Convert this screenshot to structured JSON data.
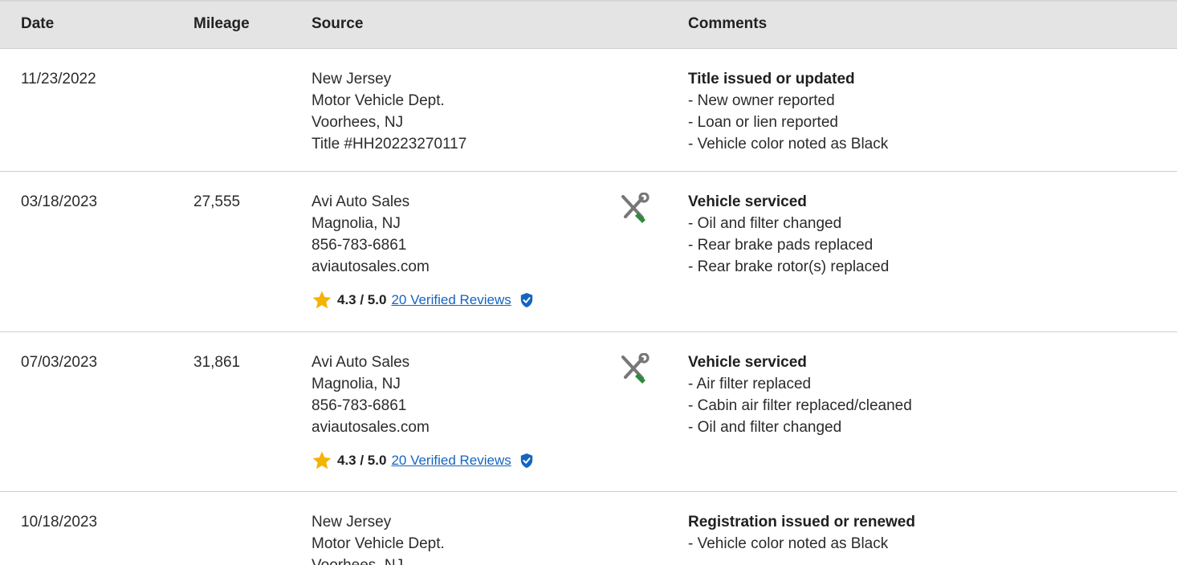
{
  "header": {
    "date": "Date",
    "mileage": "Mileage",
    "source": "Source",
    "comments": "Comments"
  },
  "rows": [
    {
      "date": "11/23/2022",
      "mileage": "",
      "source": [
        "New Jersey",
        "Motor Vehicle Dept.",
        "Voorhees, NJ",
        "Title #HH20223270117"
      ],
      "icon": "",
      "comment_title": "Title issued or updated",
      "comments": [
        "- New owner reported",
        "- Loan or lien reported",
        "- Vehicle color noted as Black"
      ]
    },
    {
      "date": "03/18/2023",
      "mileage": "27,555",
      "source": [
        "Avi Auto Sales",
        "Magnolia, NJ",
        "856-783-6861",
        "aviautosales.com"
      ],
      "icon": "service-wrench-icon",
      "rating": "4.3 / 5.0",
      "rating_value": 4.3,
      "reviews_link": "20 Verified Reviews",
      "comment_title": "Vehicle serviced",
      "comments": [
        "- Oil and filter changed",
        "- Rear brake pads replaced",
        "- Rear brake rotor(s) replaced"
      ]
    },
    {
      "date": "07/03/2023",
      "mileage": "31,861",
      "source": [
        "Avi Auto Sales",
        "Magnolia, NJ",
        "856-783-6861",
        "aviautosales.com"
      ],
      "icon": "service-wrench-icon",
      "rating": "4.3 / 5.0",
      "rating_value": 4.3,
      "reviews_link": "20 Verified Reviews",
      "comment_title": "Vehicle serviced",
      "comments": [
        "- Air filter replaced",
        "- Cabin air filter replaced/cleaned",
        "- Oil and filter changed"
      ]
    },
    {
      "date": "10/18/2023",
      "mileage": "",
      "source": [
        "New Jersey",
        "Motor Vehicle Dept.",
        "Voorhees, NJ"
      ],
      "icon": "",
      "comment_title": "Registration issued or renewed",
      "comments": [
        "- Vehicle color noted as Black"
      ]
    }
  ],
  "colors": {
    "header_bg": "#e4e4e4",
    "link": "#1565c0",
    "star": "#f5b301",
    "wrench_green": "#2e8b3a",
    "verified_shield": "#1565c0"
  }
}
